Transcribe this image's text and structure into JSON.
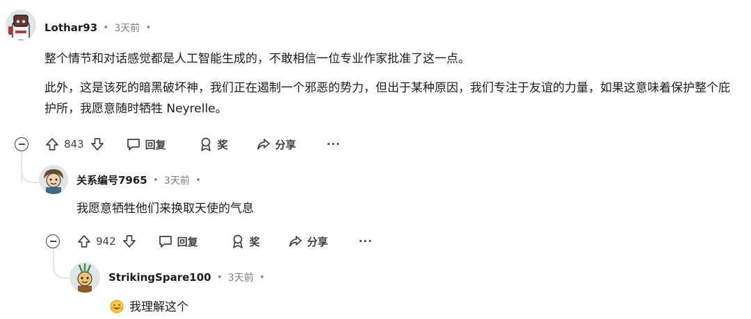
{
  "colors": {
    "thread_line": "#e2e4e6",
    "meta_gray": "#7c7f83",
    "text": "#1c1c1c"
  },
  "comments": [
    {
      "author": "Lothar93",
      "time": "3天前",
      "paragraphs": [
        "整个情节和对话感觉都是人工智能生成的，不敢相信一位专业作家批准了这一点。",
        "此外，这是该死的暗黑破坏神，我们正在遏制一个邪恶的势力，但出于某种原因，我们专注于友谊的力量，如果这意味着保护整个庇护所，我愿意随时牺牲 Neyrelle。"
      ],
      "score": "843",
      "reply_label": "回复",
      "award_label": "奖",
      "share_label": "分享",
      "more_label": "···"
    },
    {
      "author": "关系编号7965",
      "time": "3天前",
      "text": "我愿意牺牲他们来换取天使的气息",
      "score": "942",
      "reply_label": "回复",
      "award_label": "奖",
      "share_label": "分享",
      "more_label": "···"
    },
    {
      "author": "StrikingSpare100",
      "time": "3天前",
      "emoji": "smiling-face-emoji",
      "text": "我理解这个"
    }
  ],
  "icons": [
    "upvote-icon",
    "downvote-icon",
    "comment-icon",
    "award-icon",
    "share-icon",
    "collapse-icon"
  ]
}
